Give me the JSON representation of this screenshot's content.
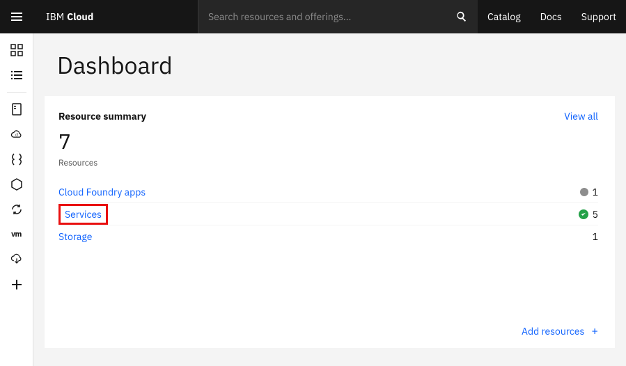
{
  "brand": {
    "prefix": "IBM",
    "name": "Cloud"
  },
  "header": {
    "search_placeholder": "Search resources and offerings...",
    "links": [
      "Catalog",
      "Docs",
      "Support"
    ]
  },
  "page": {
    "title": "Dashboard"
  },
  "card": {
    "title": "Resource summary",
    "view_all": "View all",
    "count": "7",
    "count_label": "Resources",
    "add_resources": "Add resources",
    "rows": [
      {
        "label": "Cloud Foundry apps",
        "count": "1",
        "status": "gray",
        "highlight": false
      },
      {
        "label": "Services",
        "count": "5",
        "status": "green",
        "highlight": true
      },
      {
        "label": "Storage",
        "count": "1",
        "status": "none",
        "highlight": false
      }
    ]
  }
}
